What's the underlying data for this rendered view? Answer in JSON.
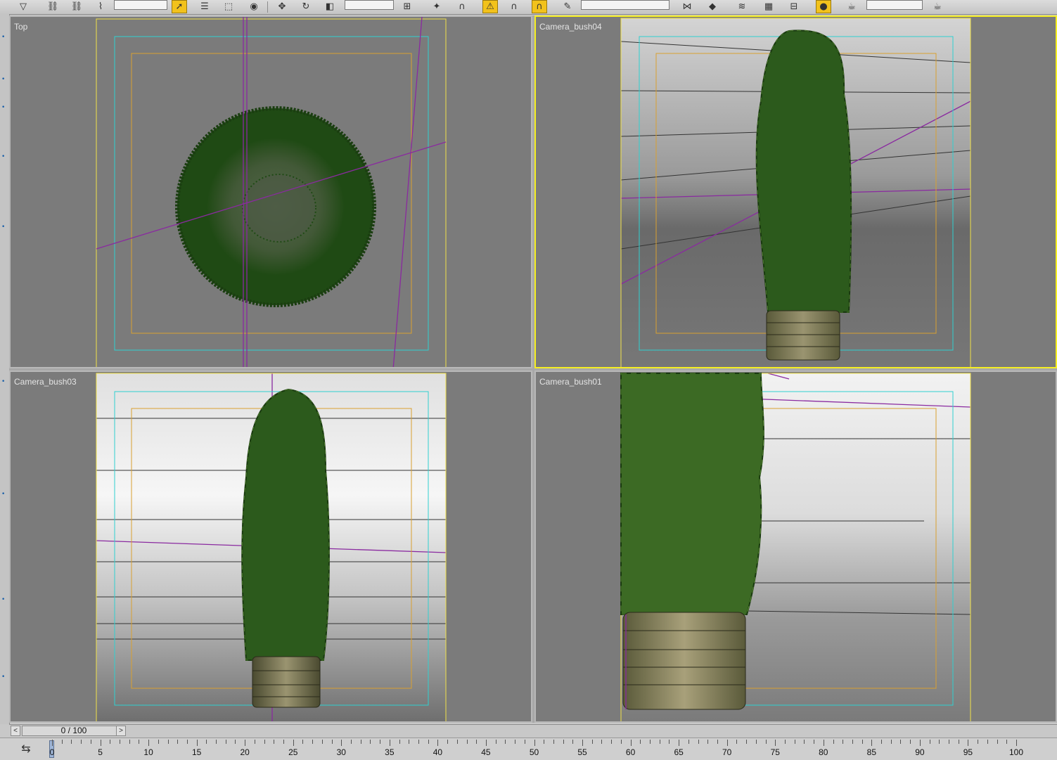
{
  "toolbar": {
    "icons": [
      "select-filter-icon",
      "link-icon",
      "unlink-icon",
      "bind-icon",
      "selection-filter-dropdown",
      "select-object-icon",
      "select-by-name-icon",
      "region-select-icon",
      "window-crossing-icon",
      "move-icon",
      "rotate-icon",
      "scale-icon",
      "reference-coordinate-dropdown",
      "pivot-icon",
      "manipulate-icon",
      "snap-icon",
      "angle-snap-icon",
      "percent-snap-icon",
      "spinner-snap-icon",
      "named-selection-dropdown",
      "mirror-icon",
      "align-icon",
      "layer-manager-icon",
      "curve-editor-icon",
      "schematic-view-icon",
      "material-editor-icon",
      "render-setup-icon",
      "render-dropdown",
      "render-icon"
    ]
  },
  "viewports": [
    {
      "label": "Top",
      "active": false
    },
    {
      "label": "Camera_bush04",
      "active": true
    },
    {
      "label": "Camera_bush03",
      "active": false
    },
    {
      "label": "Camera_bush01",
      "active": false
    }
  ],
  "time_slider": {
    "value": "0 / 100",
    "prev_label": "<",
    "next_label": ">"
  },
  "trackbar": {
    "ticks": [
      "0",
      "5",
      "10",
      "15",
      "20",
      "25",
      "30",
      "35",
      "40",
      "45",
      "50",
      "55",
      "60",
      "65",
      "70",
      "75",
      "80",
      "85",
      "90",
      "95",
      "100"
    ],
    "current_frame": 0,
    "start": 0,
    "end": 100
  },
  "colors": {
    "viewport_bg": "#7b7b7b",
    "active_border": "#f5ee22",
    "safe_frame_outer": "#f0e14a",
    "safe_frame_action": "#2fd0d0",
    "safe_frame_title": "#d9a030",
    "foliage": "#1f4a14",
    "light_line": "#8a2aa0"
  }
}
